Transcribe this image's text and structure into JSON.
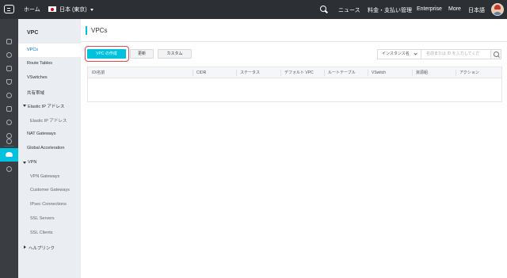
{
  "topbar": {
    "home": "ホーム",
    "region": "日本 (東京)",
    "nav": [
      "ニュース",
      "料金・支払い管理",
      "Enterprise",
      "More",
      "日本語"
    ]
  },
  "rail": {
    "icons": [
      "grid-icon",
      "cube-icon",
      "puzzle-icon",
      "database-icon",
      "shield-icon",
      "network-icon",
      "layers-icon",
      "cloud-icon",
      "globe-icon",
      "vpc-cloud-icon",
      "gear-icon"
    ]
  },
  "sidebar": {
    "title": "VPC",
    "items": [
      {
        "label": "VPCs"
      },
      {
        "label": "Route Tables"
      },
      {
        "label": "VSwitches"
      },
      {
        "label": "共有帯域"
      },
      {
        "label": "Elastic IP アドレス"
      },
      {
        "label": "Elastic IP アドレス"
      },
      {
        "label": "NAT Gateways"
      },
      {
        "label": "Global Acceleration"
      },
      {
        "label": "VPN"
      },
      {
        "label": "VPN Gateways"
      },
      {
        "label": "Customer Gateways"
      },
      {
        "label": "IPsec Connections"
      },
      {
        "label": "SSL Servers"
      },
      {
        "label": "SSL Clients"
      },
      {
        "label": "ヘルプリンク"
      }
    ]
  },
  "main": {
    "title": "VPCs",
    "create_label": "VPC の作成",
    "refresh_label": "更新",
    "custom_label": "カスタム",
    "filter_select": "インスタンス名",
    "filter_placeholder": "名前または ID を入力してくだ",
    "columns": [
      "ID/名前",
      "CIDR",
      "ステータス",
      "デフォルト VPC",
      "ルートテーブル",
      "VSwitch",
      "資源組",
      "アクション"
    ]
  },
  "colors": {
    "accent": "#00c1de",
    "topbar": "#2c2f33",
    "highlight": "#e64552"
  }
}
